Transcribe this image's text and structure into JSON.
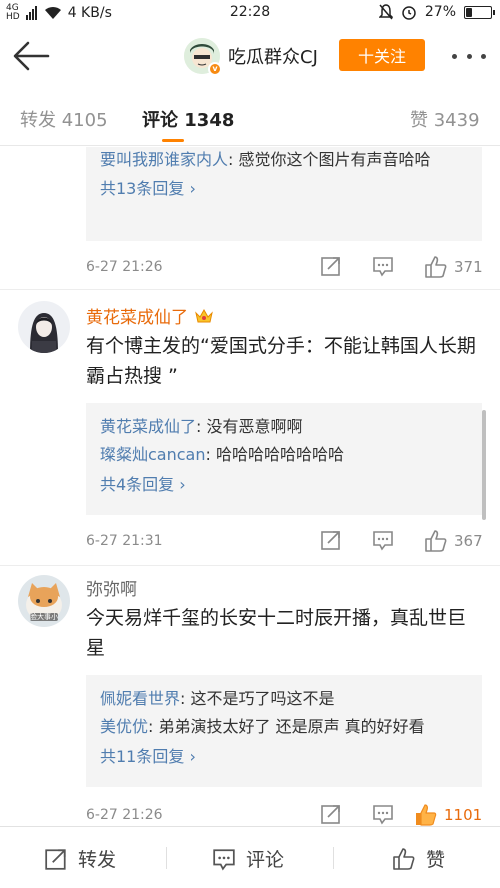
{
  "status_bar": {
    "signal_top": "4G",
    "signal_bottom": "HD",
    "speed": "4 KB/s",
    "time": "22:28",
    "battery": "27%",
    "battery_level": 0.27
  },
  "nav": {
    "username": "吃瓜群众CJ",
    "follow_label": "十关注"
  },
  "tabs": [
    {
      "label": "转发",
      "count": "4105"
    },
    {
      "label": "评论",
      "count": "1348"
    },
    {
      "label": "赞",
      "count": "3439"
    }
  ],
  "comments": [
    {
      "replies": [
        {
          "who": "要叫我那谁家内人",
          "sep": ": ",
          "text": "感觉你这个图片有声音哈哈"
        }
      ],
      "reply_count": "共13条回复",
      "time": "6-27 21:26",
      "likes": "371"
    },
    {
      "name": "黄花菜成仙了",
      "text": "有个博主发的“爱国式分手：不能让韩国人长期霸占热搜 ”",
      "replies": [
        {
          "who": "黄花菜成仙了",
          "sep": ": ",
          "text": "没有恶意啊啊"
        },
        {
          "who": "璨粲灿cancan",
          "sep": ": ",
          "text": "哈哈哈哈哈哈哈哈"
        }
      ],
      "reply_count": "共4条回复",
      "time": "6-27 21:31",
      "likes": "367"
    },
    {
      "name": "弥弥啊",
      "avatar_caption": "脸大事小",
      "text": "今天易烊千玺的长安十二时辰开播，真乱世巨星",
      "replies": [
        {
          "who": "佩妮看世界",
          "sep": ": ",
          "text": "这不是巧了吗这不是"
        },
        {
          "who": "美优优",
          "sep": ": ",
          "text": "弟弟演技太好了 还是原声 真的好好看"
        }
      ],
      "reply_count": "共11条回复",
      "time": "6-27 21:26",
      "likes": "1101"
    }
  ],
  "bottom_bar": {
    "repost": "转发",
    "comment": "评论",
    "like": "赞"
  },
  "colors": {
    "accent": "#ff8200",
    "link": "#507daf",
    "vip_name": "#e86b0c"
  }
}
